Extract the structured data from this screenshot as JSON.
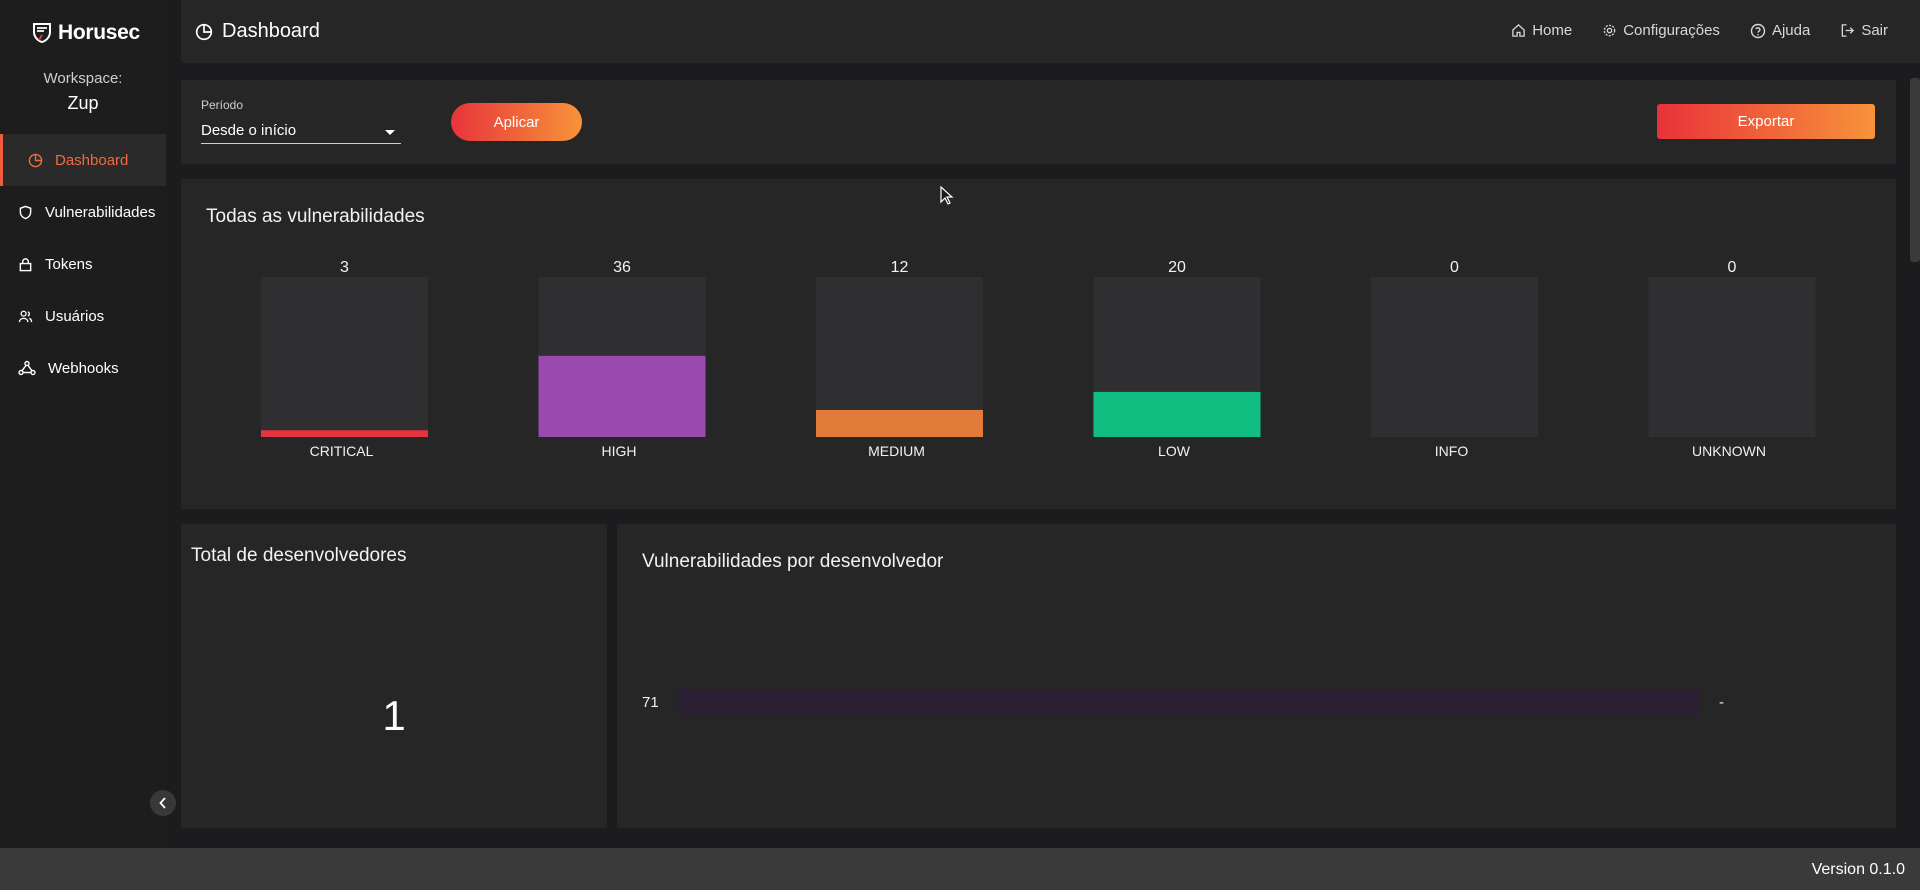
{
  "app": {
    "name": "Horusec",
    "workspace_label": "Workspace:",
    "workspace_name": "Zup",
    "version": "Version 0.1.0"
  },
  "sidebar": {
    "items": [
      {
        "label": "Dashboard",
        "icon": "pie-chart-icon",
        "active": true
      },
      {
        "label": "Vulnerabilidades",
        "icon": "shield-icon",
        "active": false
      },
      {
        "label": "Tokens",
        "icon": "lock-icon",
        "active": false
      },
      {
        "label": "Usuários",
        "icon": "users-icon",
        "active": false
      },
      {
        "label": "Webhooks",
        "icon": "webhook-icon",
        "active": false
      }
    ]
  },
  "header": {
    "title": "Dashboard",
    "nav": [
      {
        "label": "Home",
        "icon": "home-icon"
      },
      {
        "label": "Configurações",
        "icon": "gear-icon"
      },
      {
        "label": "Ajuda",
        "icon": "help-icon"
      },
      {
        "label": "Sair",
        "icon": "logout-icon"
      }
    ]
  },
  "filters": {
    "period_label": "Período",
    "period_value": "Desde o início",
    "apply_label": "Aplicar",
    "export_label": "Exportar"
  },
  "colors": {
    "accent": "#ef5b3b",
    "critical": "#e5343e",
    "high": "#9a4aae",
    "medium": "#e07b39",
    "low": "#10be82",
    "track": "#2f2f32",
    "dev_bar": "#2b1f33"
  },
  "chart_data": [
    {
      "type": "bar",
      "title": "Todas as vulnerabilidades",
      "categories": [
        "CRITICAL",
        "HIGH",
        "MEDIUM",
        "LOW",
        "INFO",
        "UNKNOWN"
      ],
      "values": [
        3,
        36,
        12,
        20,
        0,
        0
      ],
      "ylim": [
        0,
        71
      ],
      "legend": "none",
      "grid": false
    },
    {
      "type": "bar",
      "orientation": "horizontal",
      "title": "Vulnerabilidades por desenvolvedor",
      "categories": [
        "-"
      ],
      "values": [
        71
      ],
      "legend": "none",
      "grid": false
    }
  ],
  "developers": {
    "title": "Total de desenvolvedores",
    "total": "1"
  }
}
